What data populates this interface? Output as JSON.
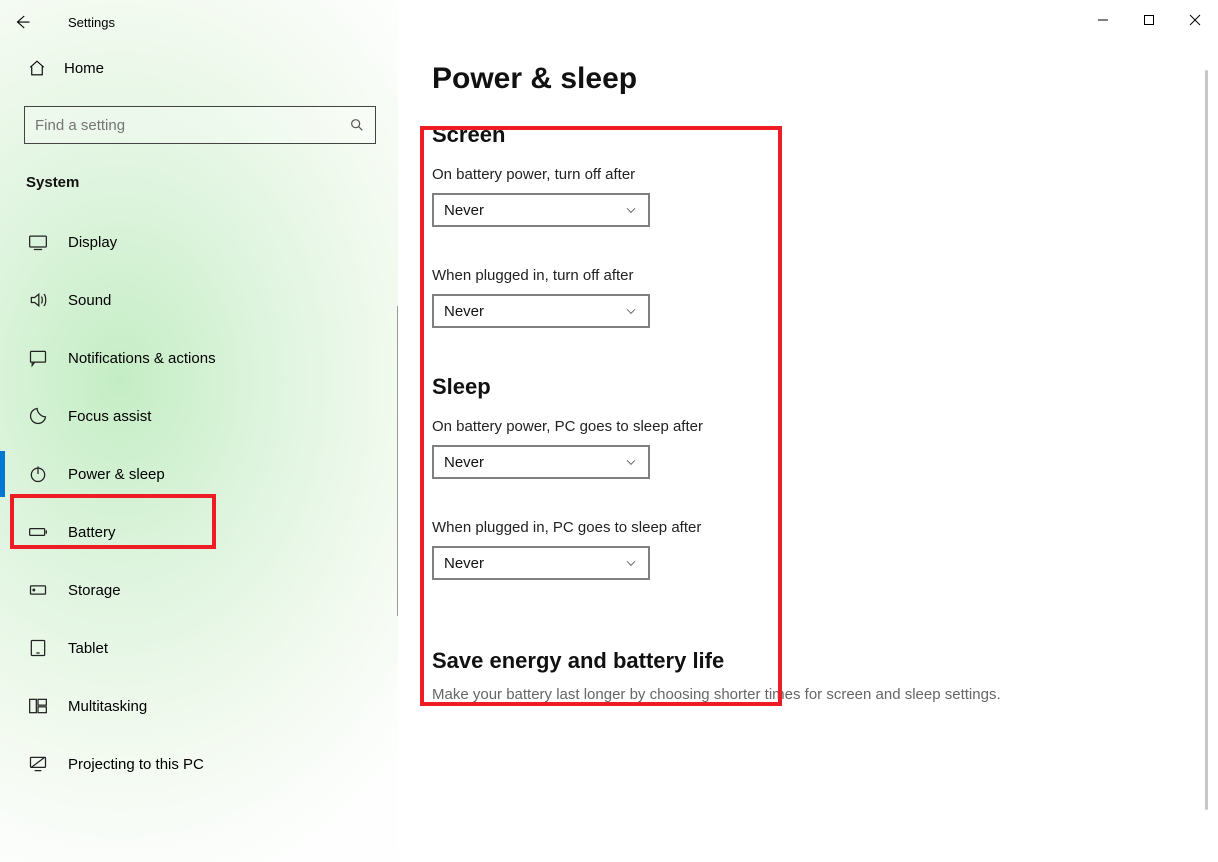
{
  "titlebar": {
    "title": "Settings"
  },
  "sidebar": {
    "home": "Home",
    "search_placeholder": "Find a setting",
    "section": "System",
    "items": [
      {
        "id": "display",
        "label": "Display"
      },
      {
        "id": "sound",
        "label": "Sound"
      },
      {
        "id": "notifications",
        "label": "Notifications & actions"
      },
      {
        "id": "focus-assist",
        "label": "Focus assist"
      },
      {
        "id": "power-sleep",
        "label": "Power & sleep",
        "active": true
      },
      {
        "id": "battery",
        "label": "Battery"
      },
      {
        "id": "storage",
        "label": "Storage"
      },
      {
        "id": "tablet",
        "label": "Tablet"
      },
      {
        "id": "multitasking",
        "label": "Multitasking"
      },
      {
        "id": "projecting",
        "label": "Projecting to this PC"
      }
    ]
  },
  "main": {
    "title": "Power & sleep",
    "screen": {
      "heading": "Screen",
      "battery_label": "On battery power, turn off after",
      "battery_value": "Never",
      "plugged_label": "When plugged in, turn off after",
      "plugged_value": "Never"
    },
    "sleep": {
      "heading": "Sleep",
      "battery_label": "On battery power, PC goes to sleep after",
      "battery_value": "Never",
      "plugged_label": "When plugged in, PC goes to sleep after",
      "plugged_value": "Never"
    },
    "save": {
      "heading": "Save energy and battery life",
      "desc": "Make your battery last longer by choosing shorter times for screen and sleep settings."
    }
  }
}
